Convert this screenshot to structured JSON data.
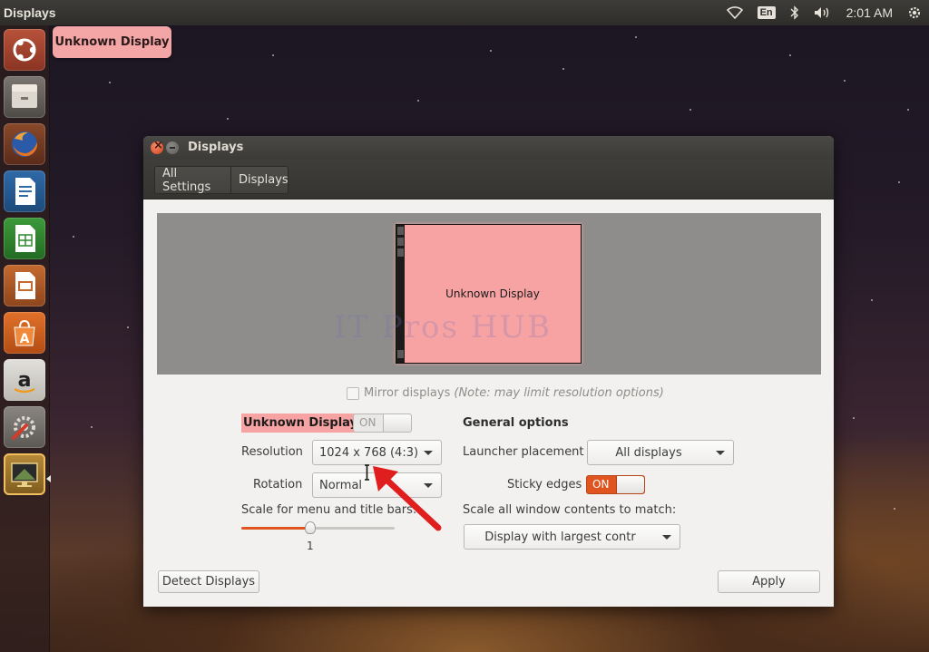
{
  "top_panel": {
    "app_title": "Displays",
    "keyboard_layout": "En",
    "clock": "2:01 AM",
    "icons": [
      "wifi-icon",
      "keyboard-icon",
      "bluetooth-icon",
      "volume-icon",
      "power-gear-icon"
    ]
  },
  "launcher": {
    "items": [
      {
        "name": "dash-home-icon"
      },
      {
        "name": "files-icon"
      },
      {
        "name": "firefox-icon"
      },
      {
        "name": "libreoffice-writer-icon"
      },
      {
        "name": "libreoffice-calc-icon"
      },
      {
        "name": "libreoffice-impress-icon"
      },
      {
        "name": "software-center-icon"
      },
      {
        "name": "amazon-icon"
      },
      {
        "name": "system-settings-icon"
      },
      {
        "name": "displays-app-icon"
      }
    ]
  },
  "tooltip": {
    "text": "Unknown Display"
  },
  "window": {
    "title": "Displays",
    "breadcrumbs": [
      "All Settings",
      "Displays"
    ],
    "preview": {
      "monitor_label": "Unknown Display",
      "watermark": "IT Pros HUB"
    },
    "mirror": {
      "label": "Mirror displays",
      "note": "(Note: may limit resolution options)",
      "checked": false
    },
    "display": {
      "name": "Unknown Display",
      "switch_state": "ON",
      "enabled": true,
      "resolution_label": "Resolution",
      "resolution_value": "1024 x 768 (4:3)",
      "rotation_label": "Rotation",
      "rotation_value": "Normal",
      "scale_label": "Scale for menu and title bars:",
      "scale_value": "1",
      "scale_fraction": 0.45
    },
    "general": {
      "heading": "General options",
      "launcher_placement_label": "Launcher placement",
      "launcher_placement_value": "All displays",
      "sticky_edges_label": "Sticky edges",
      "sticky_edges_state": "ON",
      "scale_all_label": "Scale all window contents to match:",
      "scale_all_value": "Display with largest contr"
    },
    "buttons": {
      "detect": "Detect Displays",
      "apply": "Apply"
    }
  },
  "colors": {
    "accent": "#e0551f",
    "display_highlight": "#f8a3a3",
    "panel": "#3c3b37"
  }
}
